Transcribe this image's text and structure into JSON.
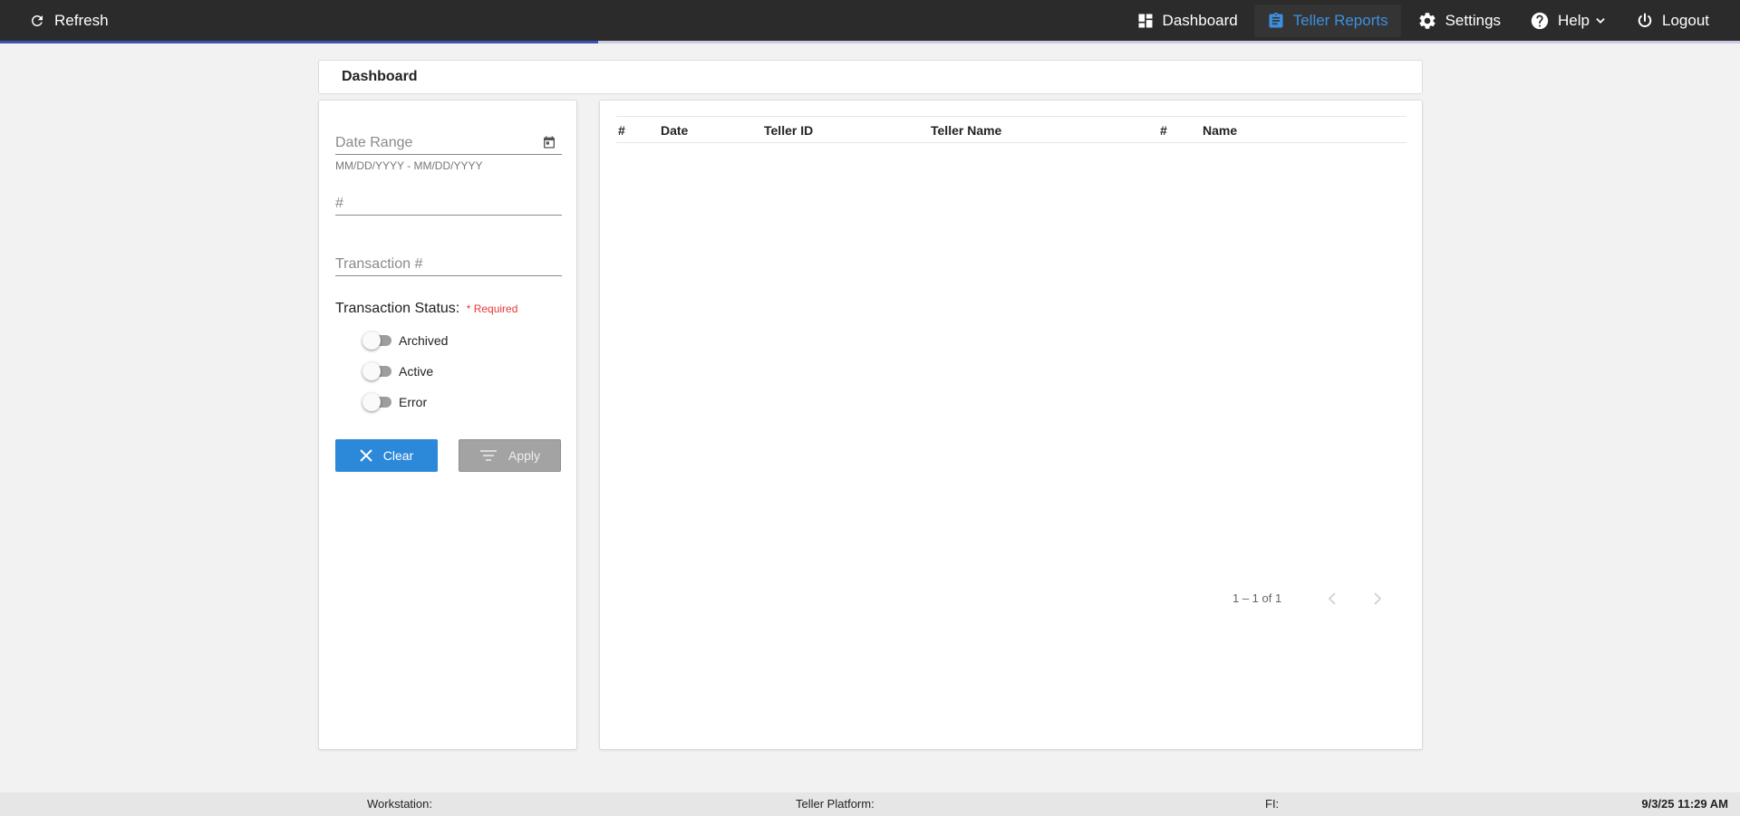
{
  "topbar": {
    "refresh_label": "Refresh",
    "nav": [
      {
        "label": "Dashboard",
        "icon": "dashboard-icon"
      },
      {
        "label": "Teller Reports",
        "icon": "clipboard-icon",
        "active": true
      },
      {
        "label": "Settings",
        "icon": "gear-icon"
      },
      {
        "label": "Help",
        "icon": "help-icon"
      },
      {
        "label": "Logout",
        "icon": "power-icon"
      }
    ],
    "progress_fraction": 0.344,
    "accent_color": "#3d8fe0"
  },
  "header": {
    "title": "Dashboard"
  },
  "filters": {
    "date_range": {
      "placeholder": "Date Range",
      "hint": "MM/DD/YYYY - MM/DD/YYYY"
    },
    "number": {
      "placeholder": "#"
    },
    "transaction": {
      "placeholder": "Transaction #"
    },
    "status": {
      "label": "Transaction Status:",
      "required": "* Required",
      "options": [
        {
          "label": "Archived",
          "checked": false
        },
        {
          "label": "Active",
          "checked": false
        },
        {
          "label": "Error",
          "checked": false
        }
      ]
    },
    "clear_label": "Clear",
    "apply_label": "Apply"
  },
  "table": {
    "columns": [
      "#",
      "Date",
      "Teller ID",
      "Teller Name",
      "#",
      "Name"
    ],
    "rows": []
  },
  "paginator": {
    "range": "1 – 1 of 1"
  },
  "footer": {
    "workstation": "Workstation:",
    "platform": "Teller Platform:",
    "fi": "FI:",
    "datetime": "9/3/25 11:29 AM"
  }
}
